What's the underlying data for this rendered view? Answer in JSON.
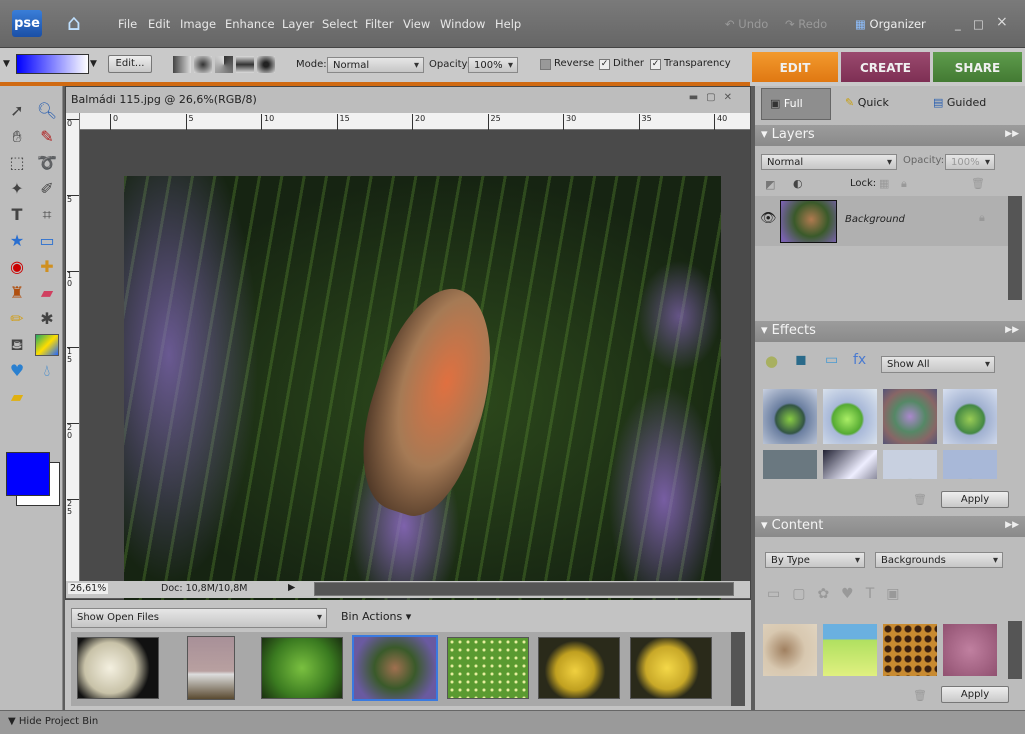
{
  "app": {
    "logo": "pse",
    "menu": [
      "File",
      "Edit",
      "Image",
      "Enhance",
      "Layer",
      "Select",
      "Filter",
      "View",
      "Window",
      "Help"
    ],
    "undo": "Undo",
    "redo": "Redo",
    "organizer": "Organizer",
    "min": "_",
    "max": "□",
    "close": "×"
  },
  "options": {
    "edit_label": "Edit...",
    "mode_label": "Mode:",
    "mode_value": "Normal",
    "opacity_label": "Opacity:",
    "opacity_value": "100%",
    "reverse": "Reverse",
    "reverse_checked": false,
    "dither": "Dither",
    "dither_checked": true,
    "transparency": "Transparency",
    "transparency_checked": true,
    "gradient_colors": [
      "#0000ff",
      "#ffffff"
    ]
  },
  "mode_tabs": [
    {
      "label": "EDIT",
      "color": "#e8801a",
      "active": true
    },
    {
      "label": "CREATE",
      "color": "#8a3a5e"
    },
    {
      "label": "SHARE",
      "color": "#4d8a3c"
    }
  ],
  "document": {
    "title": "Balmádi 115.jpg @ 26,6%(RGB/8)",
    "zoom": "26,61%",
    "doc_size": "Doc: 10,8M/10,8M",
    "ruler_top": [
      "0",
      "5",
      "10",
      "15",
      "20",
      "25",
      "30",
      "35",
      "40"
    ],
    "ruler_left": [
      "0",
      "5",
      "1\n0",
      "1\n5",
      "2\n0",
      "2\n5"
    ]
  },
  "colors": {
    "foreground": "#0000ff",
    "background": "#ffffff"
  },
  "bin": {
    "show_select": "Show Open Files",
    "actions": "Bin Actions ▾",
    "hide": "Hide Project Bin",
    "thumbs": [
      "white-rose",
      "rainbow",
      "fig-leaf",
      "butterfly-lavender",
      "meadow-flowers",
      "yellow-rose",
      "yellow-rose-2"
    ],
    "selected": 3
  },
  "edit_modes": [
    {
      "label": "Full",
      "active": true
    },
    {
      "label": "Quick"
    },
    {
      "label": "Guided"
    }
  ],
  "layers": {
    "title": "Layers",
    "blend": "Normal",
    "opacity_label": "Opacity:",
    "opacity_value": "100%",
    "lock_label": "Lock:",
    "items": [
      {
        "name": "Background",
        "visible": true,
        "locked": true
      }
    ]
  },
  "effects": {
    "title": "Effects",
    "filter": "Show All",
    "apply": "Apply"
  },
  "content": {
    "title": "Content",
    "by": "By Type",
    "category": "Backgrounds",
    "apply": "Apply"
  }
}
